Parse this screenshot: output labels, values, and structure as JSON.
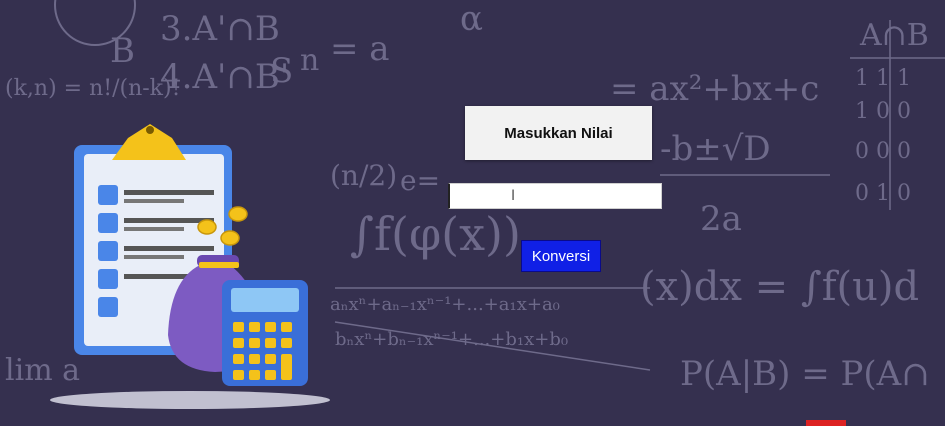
{
  "form": {
    "title": "Masukkan Nilai",
    "input_value": "",
    "input_placeholder": "",
    "button_label": "Konversi"
  },
  "colors": {
    "background": "#35304f",
    "button": "#1020e6",
    "title_box": "#f2f2f2"
  },
  "icons": [
    "text-cursor-icon",
    "clipboard-icon",
    "money-bag-icon",
    "calculator-icon",
    "coin-icon"
  ]
}
